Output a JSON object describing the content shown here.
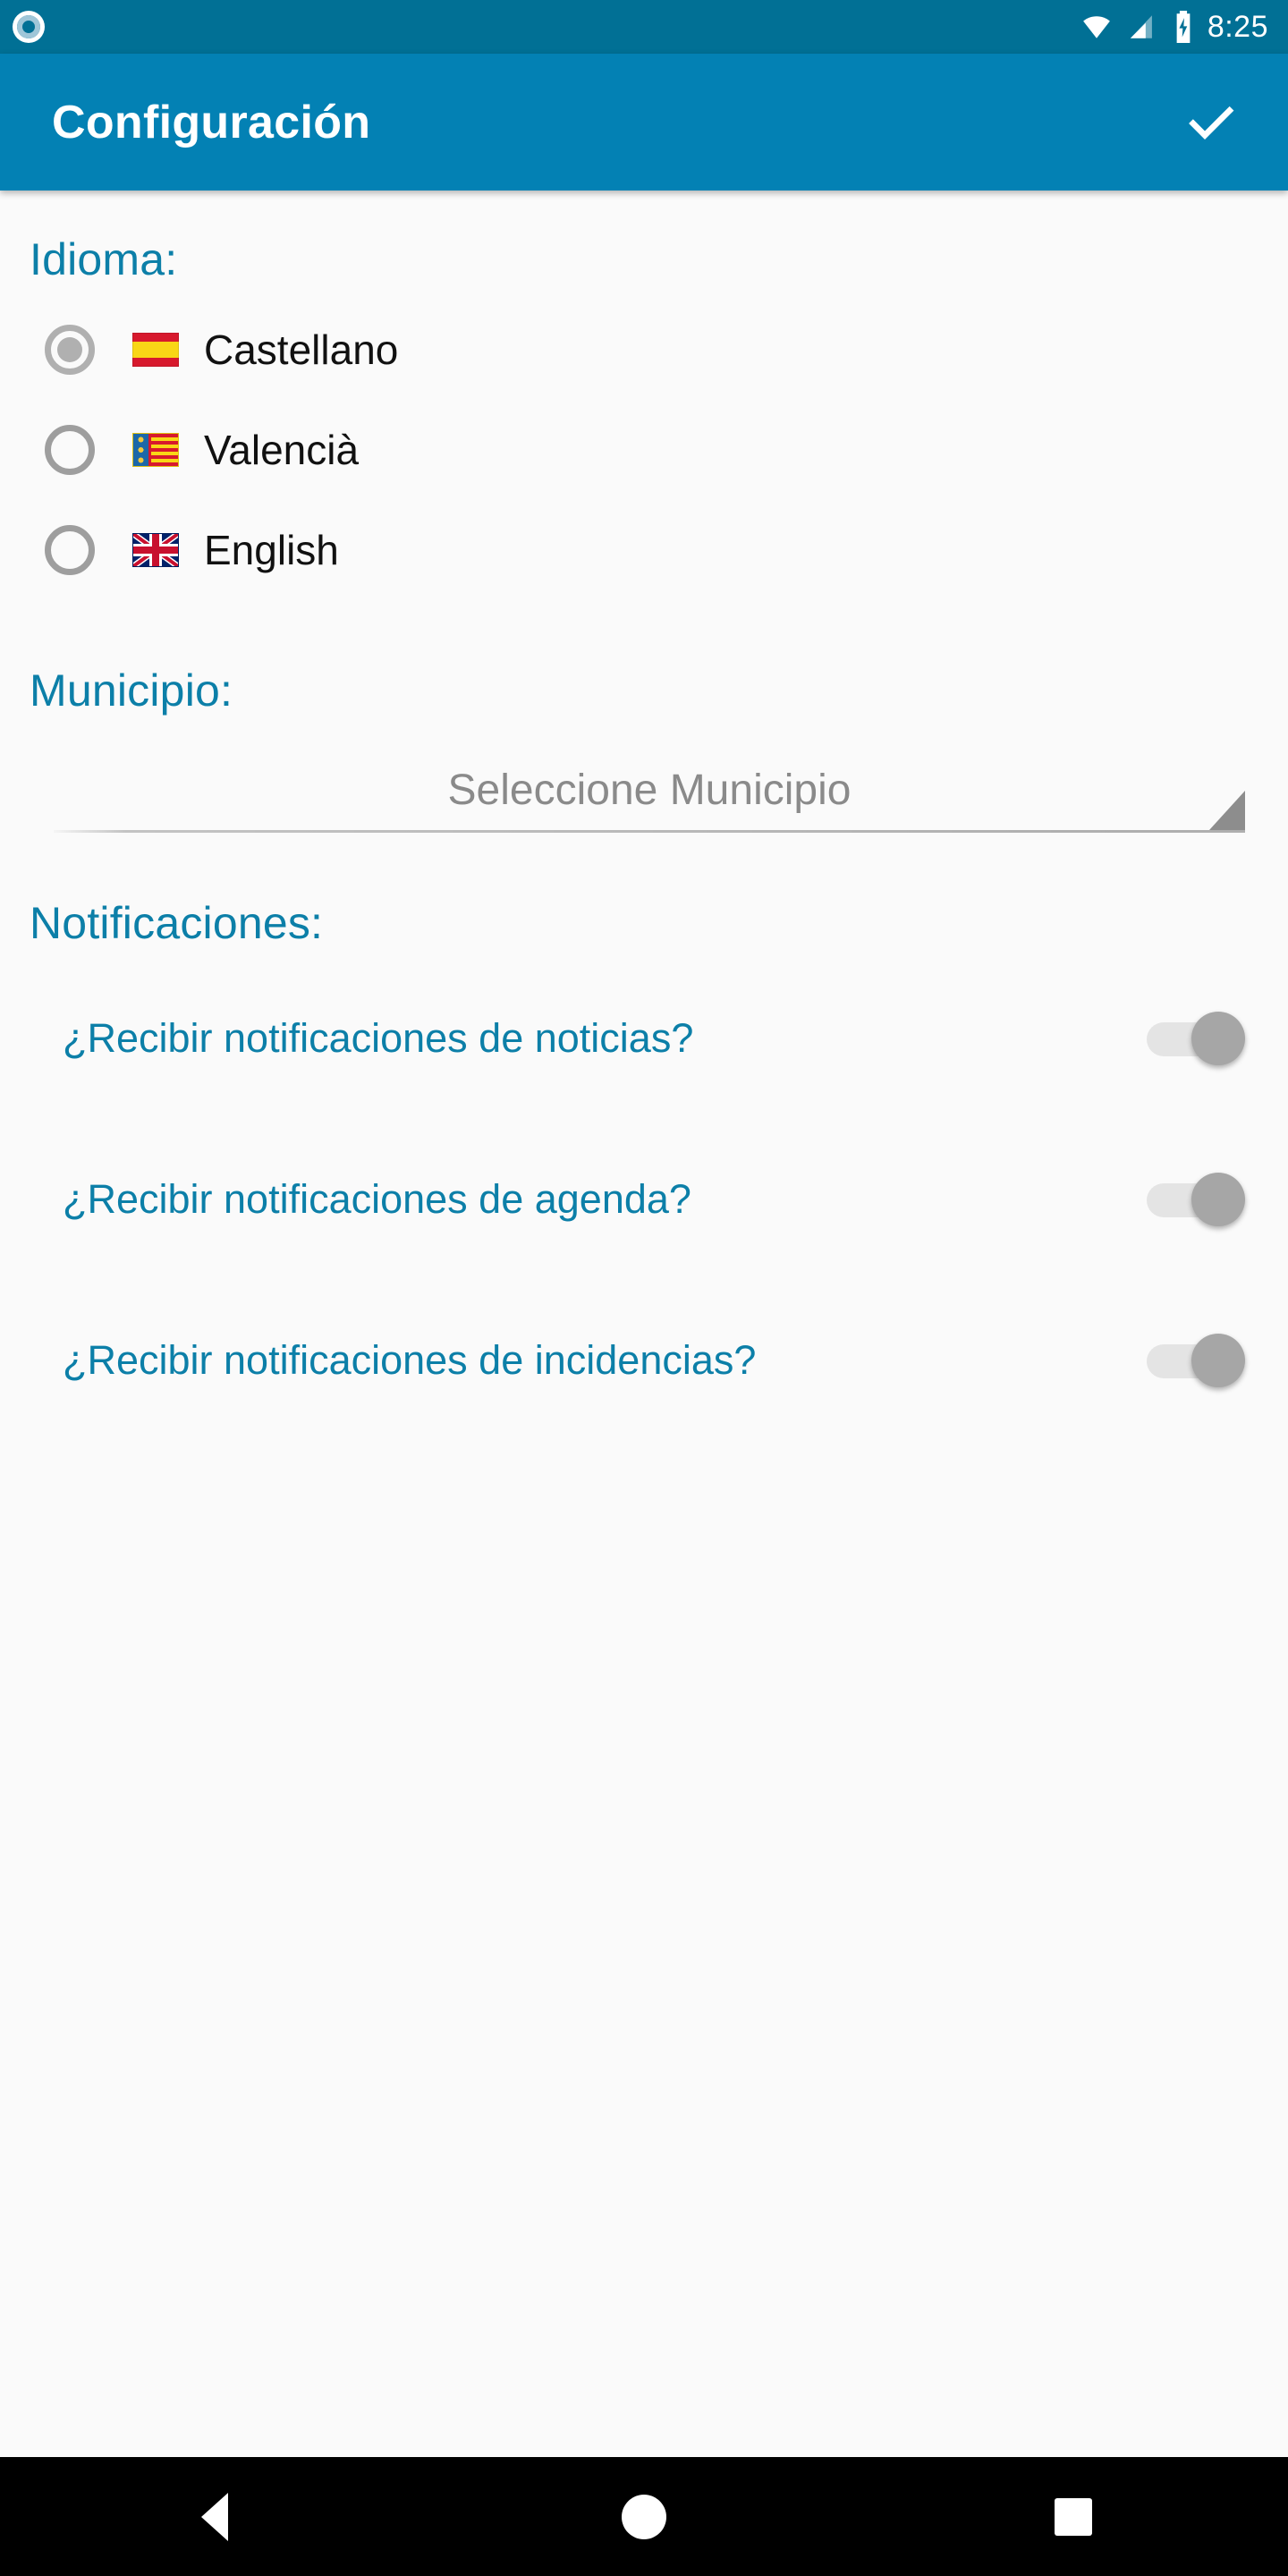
{
  "status_bar": {
    "notification_icon": "circle-notification-icon",
    "wifi_icon": "wifi-icon",
    "signal_icon": "cellular-signal-icon",
    "battery_icon": "battery-charging-icon",
    "time": "8:25"
  },
  "app_bar": {
    "title": "Configuración",
    "action_icon": "check-icon"
  },
  "language_section": {
    "header": "Idioma:",
    "options": [
      {
        "label": "Castellano",
        "flag": "flag-spain",
        "selected": true
      },
      {
        "label": "Valencià",
        "flag": "flag-valencia",
        "selected": false
      },
      {
        "label": "English",
        "flag": "flag-united-kingdom",
        "selected": false
      }
    ]
  },
  "municipality_section": {
    "header": "Municipio:",
    "spinner_value": "Seleccione Municipio",
    "dropdown_icon": "dropdown-triangle-icon"
  },
  "notifications_section": {
    "header": "Notificaciones:",
    "items": [
      {
        "label": "¿Recibir notificaciones de noticias?",
        "enabled": false
      },
      {
        "label": "¿Recibir notificaciones de agenda?",
        "enabled": false
      },
      {
        "label": "¿Recibir notificaciones de incidencias?",
        "enabled": false
      }
    ]
  },
  "navigation_bar": {
    "back": "back-icon",
    "home": "home-icon",
    "recents": "recents-icon"
  },
  "colors": {
    "status_bar": "#017095",
    "app_bar": "#0381b4",
    "accent_text": "#0c7fa8",
    "content_bg": "#fafafa",
    "switch_thumb": "#a6a6a6",
    "nav_bar": "#000000"
  }
}
